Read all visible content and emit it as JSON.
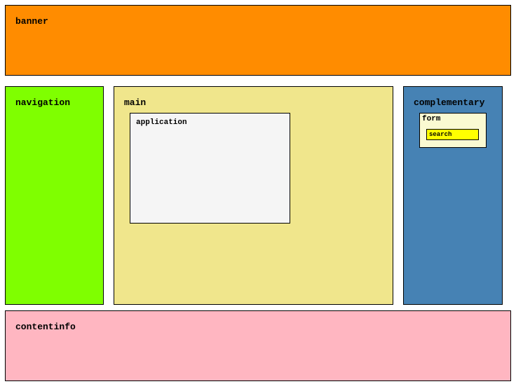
{
  "regions": {
    "banner": {
      "label": "banner",
      "color": "#FF8C00"
    },
    "navigation": {
      "label": "navigation",
      "color": "#7FFF00"
    },
    "main": {
      "label": "main",
      "color": "#F0E68C"
    },
    "application": {
      "label": "application",
      "color": "#F5F5F5"
    },
    "complementary": {
      "label": "complementary",
      "color": "#4682B4"
    },
    "form": {
      "label": "form",
      "color": "#FAFAD2"
    },
    "search": {
      "label": "search",
      "color": "#FFFF00"
    },
    "contentinfo": {
      "label": "contentinfo",
      "color": "#FFB6C1"
    }
  }
}
